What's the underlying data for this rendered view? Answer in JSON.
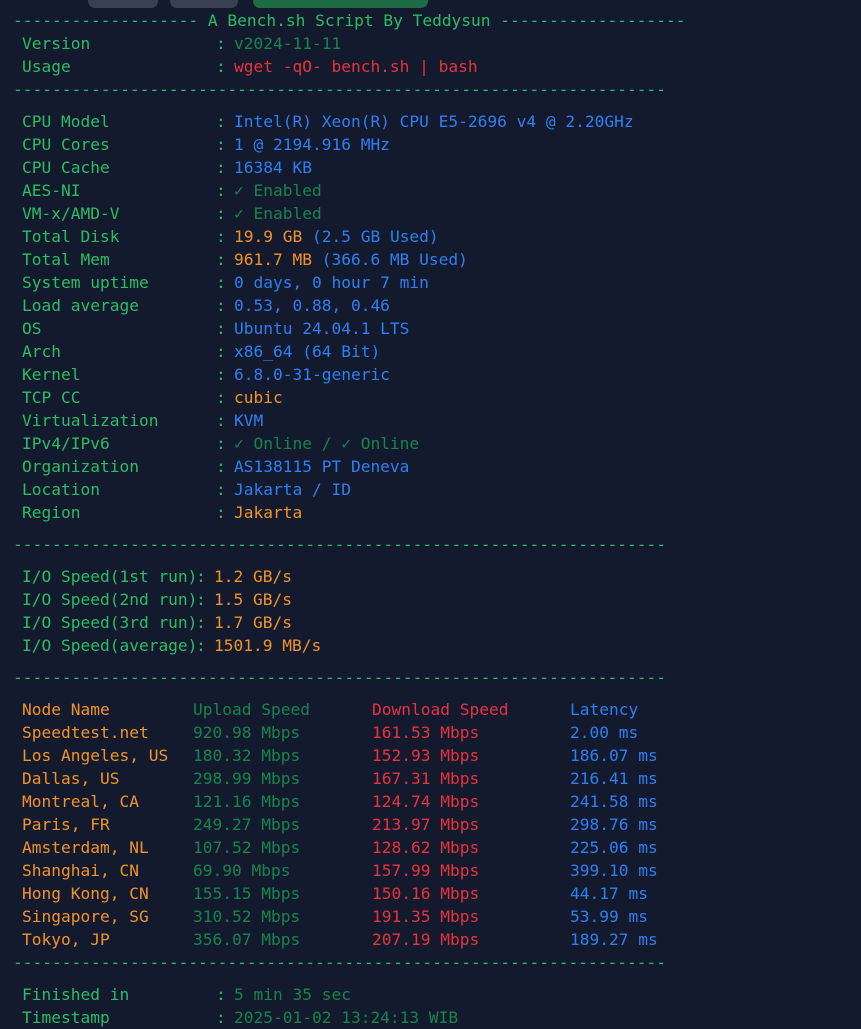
{
  "window": {
    "background_color": "#141a2e",
    "chrome_buttons": [
      {
        "name": "toolbar-button-1",
        "color": "#39404f"
      },
      {
        "name": "toolbar-button-2",
        "color": "#39404f"
      },
      {
        "name": "toolbar-button-3",
        "color": "#1e6b46"
      }
    ]
  },
  "colors": {
    "green": "#2bbd63",
    "dim_green": "#15854b",
    "blue": "#2f7ff0",
    "orange": "#f0932b",
    "red": "#e8323c"
  },
  "header": {
    "dashes_left": "-------------------",
    "title": " A Bench.sh Script By Teddysun ",
    "dashes_right": "-------------------"
  },
  "separator": "-------------------------------------------------------------------",
  "script_info": [
    {
      "label": "Version",
      "value": "v2024-11-11",
      "style": "dimgreen"
    },
    {
      "label": "Usage",
      "value": "wget -qO- bench.sh | bash",
      "style": "red"
    }
  ],
  "system_info": [
    {
      "label": "CPU Model",
      "value": "Intel(R) Xeon(R) CPU E5-2696 v4 @ 2.20GHz",
      "style": "blue"
    },
    {
      "label": "CPU Cores",
      "value": "1 @ 2194.916 MHz",
      "style": "blue"
    },
    {
      "label": "CPU Cache",
      "value": "16384 KB",
      "style": "blue"
    },
    {
      "label": "AES-NI",
      "value": "✓ Enabled",
      "style": "dimgreen"
    },
    {
      "label": "VM-x/AMD-V",
      "value": "✓ Enabled",
      "style": "dimgreen"
    },
    {
      "label": "Total Disk",
      "value": "19.9 GB",
      "value2": " (2.5 GB Used)",
      "style": "orange",
      "style2": "blue"
    },
    {
      "label": "Total Mem",
      "value": "961.7 MB",
      "value2": " (366.6 MB Used)",
      "style": "orange",
      "style2": "blue"
    },
    {
      "label": "System uptime",
      "value": "0 days, 0 hour 7 min",
      "style": "blue"
    },
    {
      "label": "Load average",
      "value": "0.53, 0.88, 0.46",
      "style": "blue"
    },
    {
      "label": "OS",
      "value": "Ubuntu 24.04.1 LTS",
      "style": "blue"
    },
    {
      "label": "Arch",
      "value": "x86_64 (64 Bit)",
      "style": "blue"
    },
    {
      "label": "Kernel",
      "value": "6.8.0-31-generic",
      "style": "blue"
    },
    {
      "label": "TCP CC",
      "value": "cubic",
      "style": "orange"
    },
    {
      "label": "Virtualization",
      "value": "KVM",
      "style": "blue"
    },
    {
      "label": "IPv4/IPv6",
      "value": "✓ Online / ✓ Online",
      "style": "dimgreen"
    },
    {
      "label": "Organization",
      "value": "AS138115 PT Deneva",
      "style": "blue"
    },
    {
      "label": "Location",
      "value": "Jakarta / ID",
      "style": "blue"
    },
    {
      "label": "Region",
      "value": "Jakarta",
      "style": "orange"
    }
  ],
  "io_speed": [
    {
      "label": "I/O Speed(1st run)",
      "value": "1.2 GB/s",
      "style": "orange"
    },
    {
      "label": "I/O Speed(2nd run)",
      "value": "1.5 GB/s",
      "style": "orange"
    },
    {
      "label": "I/O Speed(3rd run)",
      "value": "1.7 GB/s",
      "style": "orange"
    },
    {
      "label": "I/O Speed(average)",
      "value": "1501.9 MB/s",
      "style": "orange"
    }
  ],
  "speedtest": {
    "columns": [
      "Node Name",
      "Upload Speed",
      "Download Speed",
      "Latency"
    ],
    "rows": [
      {
        "node": "Speedtest.net",
        "upload": "920.98 Mbps",
        "download": "161.53 Mbps",
        "latency": "2.00 ms"
      },
      {
        "node": "Los Angeles, US",
        "upload": "180.32 Mbps",
        "download": "152.93 Mbps",
        "latency": "186.07 ms"
      },
      {
        "node": "Dallas, US",
        "upload": "298.99 Mbps",
        "download": "167.31 Mbps",
        "latency": "216.41 ms"
      },
      {
        "node": "Montreal, CA",
        "upload": "121.16 Mbps",
        "download": "124.74 Mbps",
        "latency": "241.58 ms"
      },
      {
        "node": "Paris, FR",
        "upload": "249.27 Mbps",
        "download": "213.97 Mbps",
        "latency": "298.76 ms"
      },
      {
        "node": "Amsterdam, NL",
        "upload": "107.52 Mbps",
        "download": "128.62 Mbps",
        "latency": "225.06 ms"
      },
      {
        "node": "Shanghai, CN",
        "upload": "69.90 Mbps",
        "download": "157.99 Mbps",
        "latency": "399.10 ms"
      },
      {
        "node": "Hong Kong, CN",
        "upload": "155.15 Mbps",
        "download": "150.16 Mbps",
        "latency": "44.17 ms"
      },
      {
        "node": "Singapore, SG",
        "upload": "310.52 Mbps",
        "download": "191.35 Mbps",
        "latency": "53.99 ms"
      },
      {
        "node": "Tokyo, JP",
        "upload": "356.07 Mbps",
        "download": "207.19 Mbps",
        "latency": "189.27 ms"
      }
    ]
  },
  "footer": [
    {
      "label": "Finished in",
      "value": "5 min 35 sec",
      "style": "dimgreen"
    },
    {
      "label": "Timestamp",
      "value": "2025-01-02 13:24:13 WIB",
      "style": "dimgreen"
    }
  ]
}
